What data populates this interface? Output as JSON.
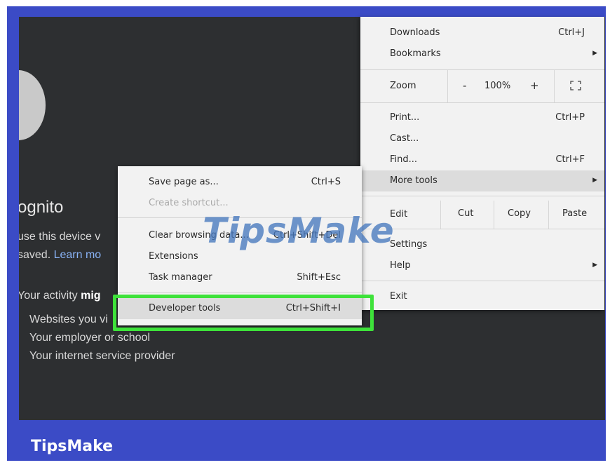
{
  "incognito": {
    "title": "ognito",
    "line1": "use this device v",
    "line2_text": "saved.",
    "line2_link": "Learn mo",
    "activity_prefix": "Your activity",
    "activity_bold": "mig",
    "bullets": [
      "Websites you vi",
      "Your employer or school",
      "Your internet service provider"
    ]
  },
  "menu": {
    "downloads": {
      "label": "Downloads",
      "shortcut": "Ctrl+J"
    },
    "bookmarks": {
      "label": "Bookmarks"
    },
    "zoom": {
      "label": "Zoom",
      "minus": "-",
      "value": "100%",
      "plus": "+"
    },
    "print": {
      "label": "Print...",
      "shortcut": "Ctrl+P"
    },
    "cast": {
      "label": "Cast..."
    },
    "find": {
      "label": "Find...",
      "shortcut": "Ctrl+F"
    },
    "more_tools": {
      "label": "More tools"
    },
    "edit": {
      "label": "Edit",
      "cut": "Cut",
      "copy": "Copy",
      "paste": "Paste"
    },
    "settings": {
      "label": "Settings"
    },
    "help": {
      "label": "Help"
    },
    "exit": {
      "label": "Exit"
    }
  },
  "submenu": {
    "save_page": {
      "label": "Save page as...",
      "shortcut": "Ctrl+S"
    },
    "create_shortcut": {
      "label": "Create shortcut..."
    },
    "clear_browsing": {
      "label": "Clear browsing data...",
      "shortcut": "Ctrl+Shift+Del"
    },
    "extensions": {
      "label": "Extensions"
    },
    "task_manager": {
      "label": "Task manager",
      "shortcut": "Shift+Esc"
    },
    "developer_tools": {
      "label": "Developer tools",
      "shortcut": "Ctrl+Shift+I"
    }
  },
  "watermark": "TipsMake",
  "brand": "TipsMake",
  "colors": {
    "frame": "#3b4bc6",
    "highlight": "#3ee23a",
    "screen": "#2d2f31"
  }
}
